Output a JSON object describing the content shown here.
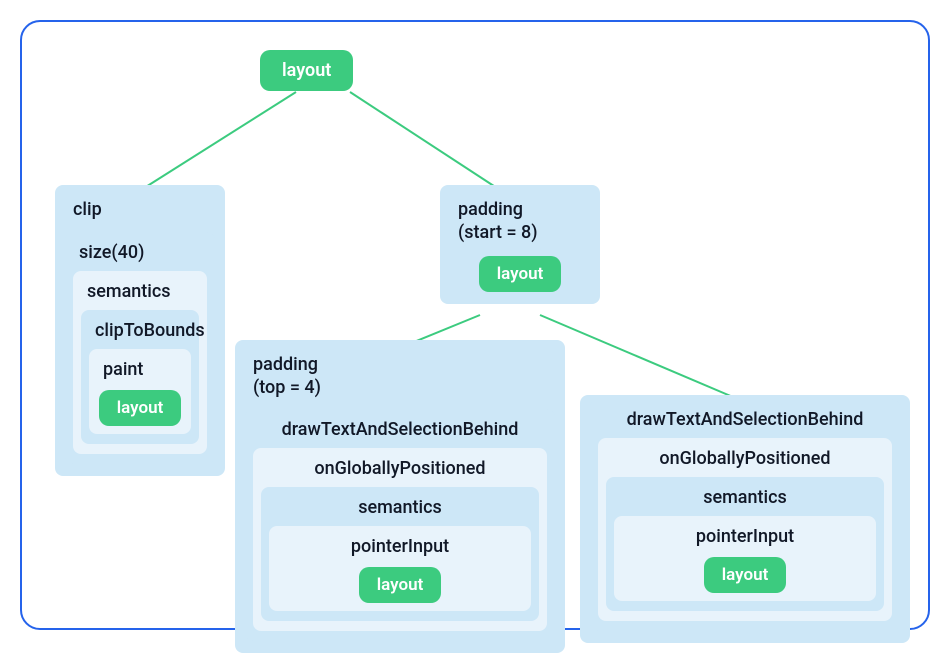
{
  "root": {
    "label": "layout"
  },
  "left": {
    "heading": "clip",
    "n1": "size(40)",
    "n2": "semantics",
    "n3": "clipToBounds",
    "n4": "paint",
    "layout": "layout"
  },
  "right": {
    "heading": "padding\n(start = 8)",
    "layout": "layout"
  },
  "bottomLeft": {
    "heading": "padding\n(top = 4)",
    "n1": "drawTextAndSelectionBehind",
    "n2": "onGloballyPositioned",
    "n3": "semantics",
    "n4": "pointerInput",
    "layout": "layout"
  },
  "bottomRight": {
    "n1": "drawTextAndSelectionBehind",
    "n2": "onGloballyPositioned",
    "n3": "semantics",
    "n4": "pointerInput",
    "layout": "layout"
  },
  "colors": {
    "frameBorder": "#2563eb",
    "pill": "#3ccb7f",
    "boxDark": "#cde7f7",
    "boxLight": "#e8f3fb"
  }
}
